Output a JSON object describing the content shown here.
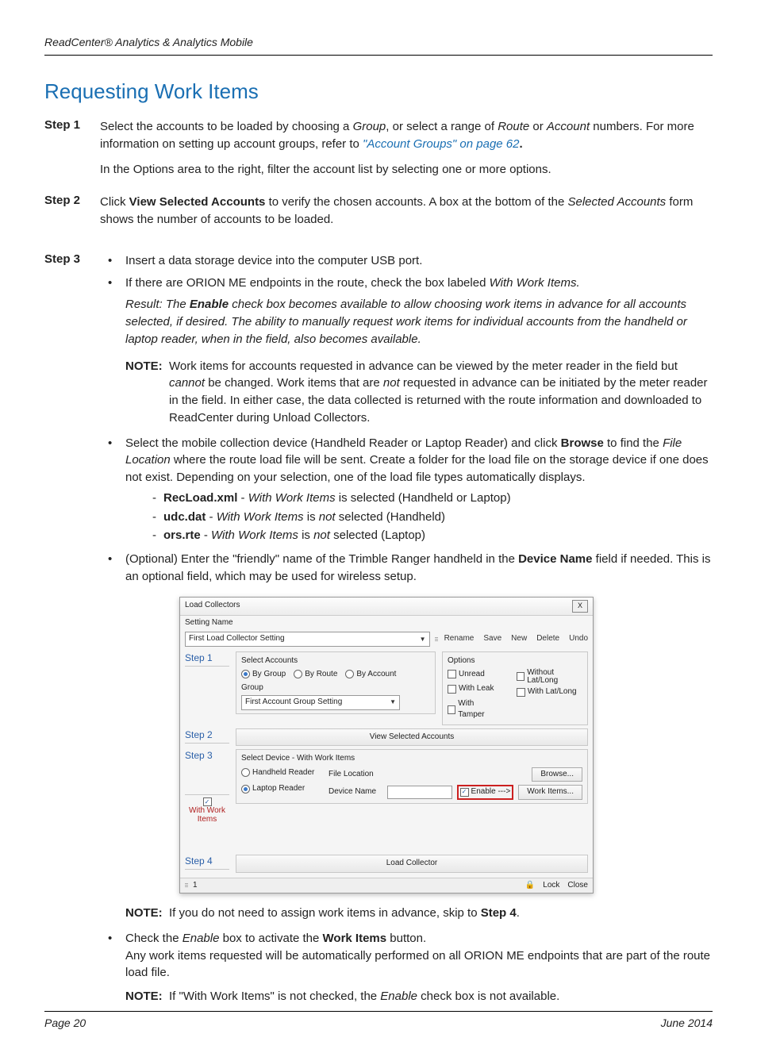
{
  "header": {
    "running_head": "ReadCenter® Analytics & Analytics Mobile"
  },
  "title": "Requesting Work Items",
  "steps": {
    "s1": {
      "label": "Step 1",
      "p1a": "Select the accounts to be loaded by choosing a ",
      "p1_group": "Group",
      "p1b": ", or select a range of ",
      "p1_route": "Route",
      "p1c": " or ",
      "p1_account": "Account",
      "p1d": " numbers. For more information on setting up account groups, refer to ",
      "xref": "\"Account Groups\" on page 62",
      "p1e": ".",
      "p2": "In the Options area to the right, filter the account list by selecting one or more options."
    },
    "s2": {
      "label": "Step 2",
      "p1a": "Click ",
      "p1_bold": "View Selected Accounts",
      "p1b": " to verify the chosen accounts. A box at the bottom of the ",
      "p1_ital": "Selected Accounts",
      "p1c": " form shows the number of accounts to be loaded."
    },
    "s3": {
      "label": "Step 3",
      "b1": "Insert a data storage device into the computer USB port.",
      "b2a": "If there are ORION ME endpoints in the route, check the box labeled ",
      "b2_ital": "With Work Items.",
      "result_a": "Result: The ",
      "result_bold": "Enable",
      "result_b": " check box becomes available to allow choosing work items in advance for all accounts selected, if desired. The ability to manually request work items for individual accounts from the handheld or laptop reader, when in the field, also becomes available.",
      "note1_label": "NOTE:",
      "note1_a": "Work items for accounts requested in advance can be viewed by the meter reader in the field but ",
      "note1_ital1": "cannot",
      "note1_b": " be changed. Work items that are ",
      "note1_ital2": "not",
      "note1_c": " requested in advance can be initiated by the meter reader in the field. In either case, the data collected is returned with the route information and downloaded to ReadCenter during Unload Collectors.",
      "b3a": "Select the mobile collection device (Handheld Reader or Laptop Reader) and click ",
      "b3_bold": "Browse",
      "b3b": " to find the ",
      "b3_ital": "File Location",
      "b3c": " where the route load file will be sent. Create a folder for the load file on the storage device if one does not exist. Depending on your selection, one of the load file types automatically displays.",
      "d1_bold": "RecLoad.xml",
      "d1_a": " - ",
      "d1_ital": "With Work Items",
      "d1_b": " is selected (Handheld or Laptop)",
      "d2_bold": "udc.dat",
      "d2_a": " - ",
      "d2_ital": "With Work Items",
      "d2_b": " is ",
      "d2_ital2": "not",
      "d2_c": " selected (Handheld)",
      "d3_bold": "ors.rte",
      "d3_a": " - ",
      "d3_ital": "With Work Items",
      "d3_b": " is ",
      "d3_ital2": "not",
      "d3_c": " selected (Laptop)",
      "b4a": "(Optional) Enter the \"friendly\" name of the Trimble Ranger handheld in the ",
      "b4_bold": "Device Name",
      "b4b": " field if needed. This is an optional field, which may be used for wireless setup.",
      "note2_label": "NOTE:",
      "note2_a": "If you do not need to assign work items in advance, skip to ",
      "note2_bold": "Step 4",
      "note2_b": ".",
      "b5a": "Check the ",
      "b5_ital": "Enable",
      "b5b": " box to activate the ",
      "b5_bold": "Work Items",
      "b5c": " button.",
      "b5d": "Any work items requested will be automatically performed on all ORION ME endpoints that are part of the route load file.",
      "note3_label": "NOTE:",
      "note3_a": "If \"With Work Items\" is not checked, the ",
      "note3_ital": "Enable",
      "note3_b": " check box is not available."
    }
  },
  "dialog": {
    "title": "Load Collectors",
    "close": "X",
    "setting_name_label": "Setting Name",
    "setting_value": "First Load Collector Setting",
    "toolbar": {
      "rename": "Rename",
      "save": "Save",
      "new": "New",
      "delete": "Delete",
      "undo": "Undo"
    },
    "step1": "Step 1",
    "select_accounts": "Select Accounts",
    "by_group": "By Group",
    "by_route": "By Route",
    "by_account": "By Account",
    "group_label": "Group",
    "group_value": "First Account Group Setting",
    "options": "Options",
    "unread": "Unread",
    "with_leak": "With Leak",
    "with_tamper": "With Tamper",
    "without_latlong": "Without Lat/Long",
    "with_latlong": "With Lat/Long",
    "step2": "Step 2",
    "view_selected": "View Selected Accounts",
    "step3": "Step 3",
    "with_work_items": "With Work Items",
    "select_device": "Select Device - With Work Items",
    "handheld": "Handheld Reader",
    "laptop": "Laptop Reader",
    "file_location": "File Location",
    "device_name": "Device Name",
    "browse": "Browse...",
    "enable": "Enable --->",
    "work_items_btn": "Work Items...",
    "step4": "Step 4",
    "load_collector": "Load Collector",
    "status_count": "1",
    "lock": "Lock",
    "close_btn": "Close"
  },
  "footer": {
    "page": "Page 20",
    "date": "June 2014"
  }
}
